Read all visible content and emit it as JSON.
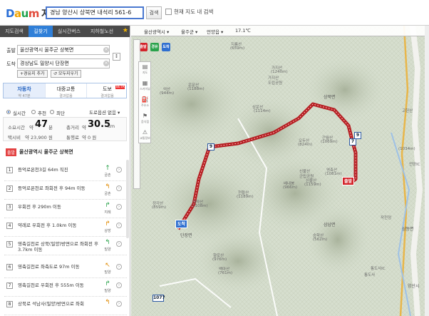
{
  "header": {
    "logo": {
      "d": "D",
      "a": "a",
      "u": "u",
      "m": "m",
      "service": "지도"
    },
    "search_value": "경남 양산시 상북면 내석리 561-6",
    "search_button": "검색",
    "in_map_label": "현재 지도 내 검색"
  },
  "tabs": [
    {
      "label": "지도검색"
    },
    {
      "label": "길찾기"
    },
    {
      "label": "실시간버스"
    },
    {
      "label": "지하철노선"
    },
    {
      "label": "★"
    }
  ],
  "route_form": {
    "start_label": "출발",
    "start_value": "울산광역시 울주군 상북면",
    "end_label": "도착",
    "end_value": "경상남도 밀양시 단장면",
    "waypoint_button": "+경유지 추가",
    "reverse_button": "↺ 모두지우기",
    "swap_icon": "↕"
  },
  "mode_tabs": [
    {
      "name": "자동차",
      "sub": "약 47분"
    },
    {
      "name": "대중교통",
      "sub": "결과없음"
    },
    {
      "name": "도보",
      "sub": "결과없음",
      "badge": "BETA"
    }
  ],
  "options": [
    {
      "label": "실시간",
      "selected": true
    },
    {
      "label": "추천",
      "selected": false
    },
    {
      "label": "최단",
      "selected": false
    }
  ],
  "option_select": "도로옵션 없음 ▾",
  "summary": {
    "time_label": "소요시간",
    "time_prefix": "약",
    "time_value": "47",
    "time_unit": "분",
    "dist_label": "총거리",
    "dist_prefix": "약",
    "dist_value": "30.5",
    "dist_unit": "km",
    "taxi_label": "택시비",
    "taxi_value": "약  23,900 원",
    "toll_label": "통행료",
    "toll_value": "약  0 원"
  },
  "route_start": {
    "badge": "출발",
    "name": "울산광역시 울주군 상북면"
  },
  "steps": [
    {
      "num": "1",
      "text": "등억로온천3길 64m 직진",
      "sub": "궁촌",
      "icon": "↑"
    },
    {
      "num": "2",
      "text": "등억로온천로 좌회전 후 94m 이동",
      "sub": "궁촌",
      "icon": "↰"
    },
    {
      "num": "3",
      "text": "우회전 후 290m 이동",
      "sub": "지례",
      "icon": "↱"
    },
    {
      "num": "4",
      "text": "약례로 우회전 후 1.0km 이동",
      "sub": "상방",
      "icon": "↱"
    },
    {
      "num": "5",
      "text": "영축길천로 상북(밀양)방면으로 좌회전 후 3.7km 이동",
      "sub": "밀양",
      "icon": "↰"
    },
    {
      "num": "6",
      "text": "영축길천로 좌측도로 97m 이동",
      "sub": "밀양",
      "icon": "↖"
    },
    {
      "num": "7",
      "text": "영축길천로 우회전 후 555m 이동",
      "sub": "밀양",
      "icon": "↱"
    },
    {
      "num": "8",
      "text": "상북로 석남사(밀양)방면으로 좌회",
      "sub": "",
      "icon": "↰"
    }
  ],
  "map": {
    "breadcrumbs": [
      "울산광역시 ▾",
      "울주군 ▾",
      "언양읍 ▾",
      "17.1℃"
    ],
    "legend": [
      {
        "label": "출발",
        "color": "#d3242a"
      },
      {
        "label": "경유",
        "color": "#2aa24b"
      },
      {
        "label": "도착",
        "color": "#2f6fd0"
      }
    ],
    "tools": [
      {
        "name": "지도",
        "icon": "▤"
      },
      {
        "name": "스카이뷰",
        "icon": "▦"
      },
      {
        "name": "주유소",
        "icon": "⛽"
      },
      {
        "name": "음식점",
        "icon": "⚑"
      },
      {
        "name": "교통정보",
        "icon": "⚠"
      }
    ],
    "labels": [
      {
        "text": "지룡산"
      },
      {
        "text": "(659m)"
      },
      {
        "text": "운문산"
      },
      {
        "text": "(1188m)"
      },
      {
        "text": "억산"
      },
      {
        "text": "(944m)"
      },
      {
        "text": "가지산"
      },
      {
        "text": "(1240m)"
      },
      {
        "text": "가지산"
      },
      {
        "text": "도립공원"
      },
      {
        "text": "상운산"
      },
      {
        "text": "(1114m)"
      },
      {
        "text": "상북면"
      },
      {
        "text": "신불산"
      },
      {
        "text": "군립공원"
      },
      {
        "text": "천황산"
      },
      {
        "text": "(1189m)"
      },
      {
        "text": "재약산"
      },
      {
        "text": "(1108m)"
      },
      {
        "text": "단장면"
      },
      {
        "text": "향로산"
      },
      {
        "text": "(976m)"
      },
      {
        "text": "백마산"
      },
      {
        "text": "(761m)"
      },
      {
        "text": "간월산"
      },
      {
        "text": "(1069m)"
      },
      {
        "text": "삼남면"
      },
      {
        "text": "삼동면"
      },
      {
        "text": "통도사IC"
      },
      {
        "text": "통도사"
      },
      {
        "text": "양산시"
      },
      {
        "text": "신불산"
      },
      {
        "text": "(1159m)"
      },
      {
        "text": "영축산"
      },
      {
        "text": "(1081m)"
      },
      {
        "text": "오두산"
      },
      {
        "text": "(824m)"
      },
      {
        "text": "배내봉"
      },
      {
        "text": "(966m)"
      },
      {
        "text": "정각산"
      },
      {
        "text": "(859m)"
      },
      {
        "text": "승학산"
      },
      {
        "text": "(562m)"
      },
      {
        "text": "고헌산"
      },
      {
        "text": "(1034m)"
      },
      {
        "text": "언양IC"
      },
      {
        "text": "작천정"
      }
    ],
    "road_shields": [
      "9",
      "9",
      "7",
      "1077"
    ],
    "start_marker": "출발",
    "end_marker": "도착"
  }
}
